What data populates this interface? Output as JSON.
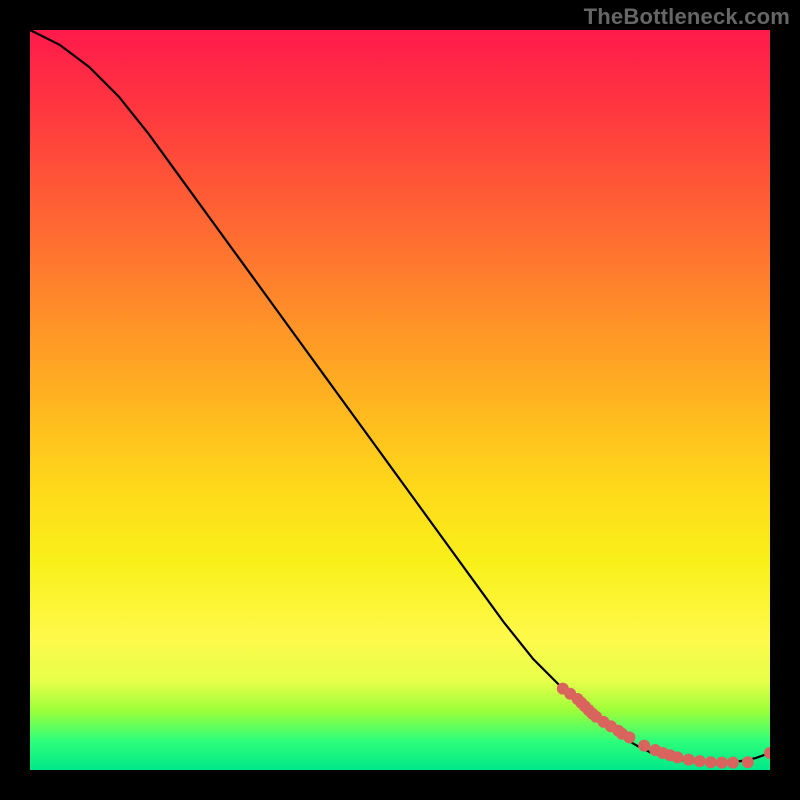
{
  "watermark": "TheBottleneck.com",
  "chart_data": {
    "type": "line",
    "title": "",
    "xlabel": "",
    "ylabel": "",
    "xlim": [
      0,
      100
    ],
    "ylim": [
      0,
      100
    ],
    "curve": {
      "x": [
        0,
        4,
        8,
        12,
        16,
        20,
        24,
        28,
        32,
        36,
        40,
        44,
        48,
        52,
        56,
        60,
        64,
        68,
        72,
        76,
        80,
        82,
        84,
        87,
        90,
        93,
        96,
        98,
        100
      ],
      "y": [
        100,
        98,
        95,
        91,
        86,
        80.5,
        75,
        69.5,
        64,
        58.5,
        53,
        47.5,
        42,
        36.5,
        31,
        25.5,
        20,
        15,
        11,
        7.5,
        4.5,
        3.3,
        2.3,
        1.5,
        1.1,
        1.0,
        1.2,
        1.6,
        2.3
      ]
    },
    "markers": {
      "x": [
        72,
        73,
        74,
        74.5,
        75,
        75.5,
        76,
        76.5,
        77.5,
        78.5,
        79.5,
        80,
        81,
        83,
        84.5,
        85.5,
        86.5,
        87.5,
        89,
        90.5,
        92,
        93.5,
        95,
        97,
        100
      ],
      "y": [
        11,
        10.3,
        9.6,
        9.1,
        8.6,
        8.1,
        7.6,
        7.2,
        6.5,
        5.9,
        5.3,
        4.9,
        4.4,
        3.3,
        2.7,
        2.3,
        2.0,
        1.7,
        1.4,
        1.2,
        1.05,
        1.0,
        1.0,
        1.05,
        2.3
      ]
    },
    "gradient_stops": [
      {
        "pos": 0,
        "color": "#ff1a4b"
      },
      {
        "pos": 50,
        "color": "#ffba1e"
      },
      {
        "pos": 82,
        "color": "#fff94a"
      },
      {
        "pos": 96,
        "color": "#2fff7a"
      },
      {
        "pos": 100,
        "color": "#00e88a"
      }
    ]
  }
}
